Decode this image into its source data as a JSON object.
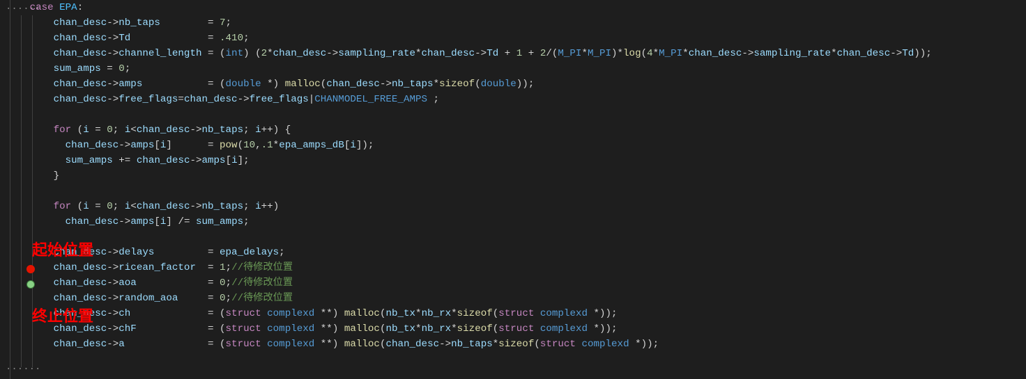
{
  "code": {
    "lines": [
      {
        "indent": 1,
        "segments": [
          [
            "kw",
            "case"
          ],
          [
            "pun",
            " "
          ],
          [
            "enum",
            "EPA"
          ],
          [
            "pun",
            ":"
          ]
        ]
      },
      {
        "indent": 3,
        "segments": [
          [
            "var",
            "chan_desc"
          ],
          [
            "op",
            "->"
          ],
          [
            "var",
            "nb_taps"
          ],
          [
            "pun",
            "        = "
          ],
          [
            "num",
            "7"
          ],
          [
            "pun",
            ";"
          ]
        ]
      },
      {
        "indent": 3,
        "segments": [
          [
            "var",
            "chan_desc"
          ],
          [
            "op",
            "->"
          ],
          [
            "var",
            "Td"
          ],
          [
            "pun",
            "             = "
          ],
          [
            "num",
            ".410"
          ],
          [
            "pun",
            ";"
          ]
        ]
      },
      {
        "indent": 3,
        "segments": [
          [
            "var",
            "chan_desc"
          ],
          [
            "op",
            "->"
          ],
          [
            "var",
            "channel_length"
          ],
          [
            "pun",
            " = ("
          ],
          [
            "type",
            "int"
          ],
          [
            "pun",
            ") ("
          ],
          [
            "num",
            "2"
          ],
          [
            "op",
            "*"
          ],
          [
            "var",
            "chan_desc"
          ],
          [
            "op",
            "->"
          ],
          [
            "var",
            "sampling_rate"
          ],
          [
            "op",
            "*"
          ],
          [
            "var",
            "chan_desc"
          ],
          [
            "op",
            "->"
          ],
          [
            "var",
            "Td"
          ],
          [
            "pun",
            " + "
          ],
          [
            "num",
            "1"
          ],
          [
            "pun",
            " + "
          ],
          [
            "num",
            "2"
          ],
          [
            "op",
            "/"
          ],
          [
            "pun",
            "("
          ],
          [
            "mac",
            "M_PI"
          ],
          [
            "op",
            "*"
          ],
          [
            "mac",
            "M_PI"
          ],
          [
            "pun",
            ")"
          ],
          [
            "op",
            "*"
          ],
          [
            "fn",
            "log"
          ],
          [
            "pun",
            "("
          ],
          [
            "num",
            "4"
          ],
          [
            "op",
            "*"
          ],
          [
            "mac",
            "M_PI"
          ],
          [
            "op",
            "*"
          ],
          [
            "var",
            "chan_desc"
          ],
          [
            "op",
            "->"
          ],
          [
            "var",
            "sampling_rate"
          ],
          [
            "op",
            "*"
          ],
          [
            "var",
            "chan_desc"
          ],
          [
            "op",
            "->"
          ],
          [
            "var",
            "Td"
          ],
          [
            "pun",
            "));"
          ]
        ]
      },
      {
        "indent": 3,
        "segments": [
          [
            "var",
            "sum_amps"
          ],
          [
            "pun",
            " = "
          ],
          [
            "num",
            "0"
          ],
          [
            "pun",
            ";"
          ]
        ]
      },
      {
        "indent": 3,
        "segments": [
          [
            "var",
            "chan_desc"
          ],
          [
            "op",
            "->"
          ],
          [
            "var",
            "amps"
          ],
          [
            "pun",
            "           = ("
          ],
          [
            "type",
            "double"
          ],
          [
            "pun",
            " "
          ],
          [
            "op",
            "*"
          ],
          [
            "pun",
            ") "
          ],
          [
            "fn",
            "malloc"
          ],
          [
            "pun",
            "("
          ],
          [
            "var",
            "chan_desc"
          ],
          [
            "op",
            "->"
          ],
          [
            "var",
            "nb_taps"
          ],
          [
            "op",
            "*"
          ],
          [
            "fn",
            "sizeof"
          ],
          [
            "pun",
            "("
          ],
          [
            "type",
            "double"
          ],
          [
            "pun",
            "));"
          ]
        ]
      },
      {
        "indent": 3,
        "segments": [
          [
            "var",
            "chan_desc"
          ],
          [
            "op",
            "->"
          ],
          [
            "var",
            "free_flags"
          ],
          [
            "op",
            "="
          ],
          [
            "var",
            "chan_desc"
          ],
          [
            "op",
            "->"
          ],
          [
            "var",
            "free_flags"
          ],
          [
            "op",
            "|"
          ],
          [
            "mac",
            "CHANMODEL_FREE_AMPS"
          ],
          [
            "pun",
            " ;"
          ]
        ]
      },
      {
        "indent": 3,
        "segments": []
      },
      {
        "indent": 3,
        "segments": [
          [
            "kw",
            "for"
          ],
          [
            "pun",
            " ("
          ],
          [
            "var",
            "i"
          ],
          [
            "pun",
            " = "
          ],
          [
            "num",
            "0"
          ],
          [
            "pun",
            "; "
          ],
          [
            "var",
            "i"
          ],
          [
            "op",
            "<"
          ],
          [
            "var",
            "chan_desc"
          ],
          [
            "op",
            "->"
          ],
          [
            "var",
            "nb_taps"
          ],
          [
            "pun",
            "; "
          ],
          [
            "var",
            "i"
          ],
          [
            "op",
            "++"
          ],
          [
            "pun",
            ") {"
          ]
        ]
      },
      {
        "indent": 4,
        "segments": [
          [
            "var",
            "chan_desc"
          ],
          [
            "op",
            "->"
          ],
          [
            "var",
            "amps"
          ],
          [
            "pun",
            "["
          ],
          [
            "var",
            "i"
          ],
          [
            "pun",
            "]      = "
          ],
          [
            "fn",
            "pow"
          ],
          [
            "pun",
            "("
          ],
          [
            "num",
            "10"
          ],
          [
            "pun",
            ","
          ],
          [
            "num",
            ".1"
          ],
          [
            "op",
            "*"
          ],
          [
            "var",
            "epa_amps_dB"
          ],
          [
            "pun",
            "["
          ],
          [
            "var",
            "i"
          ],
          [
            "pun",
            "]);"
          ]
        ]
      },
      {
        "indent": 4,
        "segments": [
          [
            "var",
            "sum_amps"
          ],
          [
            "pun",
            " "
          ],
          [
            "op",
            "+="
          ],
          [
            "pun",
            " "
          ],
          [
            "var",
            "chan_desc"
          ],
          [
            "op",
            "->"
          ],
          [
            "var",
            "amps"
          ],
          [
            "pun",
            "["
          ],
          [
            "var",
            "i"
          ],
          [
            "pun",
            "];"
          ]
        ]
      },
      {
        "indent": 3,
        "segments": [
          [
            "pun",
            "}"
          ]
        ]
      },
      {
        "indent": 3,
        "segments": []
      },
      {
        "indent": 3,
        "segments": [
          [
            "kw",
            "for"
          ],
          [
            "pun",
            " ("
          ],
          [
            "var",
            "i"
          ],
          [
            "pun",
            " = "
          ],
          [
            "num",
            "0"
          ],
          [
            "pun",
            "; "
          ],
          [
            "var",
            "i"
          ],
          [
            "op",
            "<"
          ],
          [
            "var",
            "chan_desc"
          ],
          [
            "op",
            "->"
          ],
          [
            "var",
            "nb_taps"
          ],
          [
            "pun",
            "; "
          ],
          [
            "var",
            "i"
          ],
          [
            "op",
            "++"
          ],
          [
            "pun",
            ")"
          ]
        ]
      },
      {
        "indent": 4,
        "segments": [
          [
            "var",
            "chan_desc"
          ],
          [
            "op",
            "->"
          ],
          [
            "var",
            "amps"
          ],
          [
            "pun",
            "["
          ],
          [
            "var",
            "i"
          ],
          [
            "pun",
            "] "
          ],
          [
            "op",
            "/="
          ],
          [
            "pun",
            " "
          ],
          [
            "var",
            "sum_amps"
          ],
          [
            "pun",
            ";"
          ]
        ]
      },
      {
        "indent": 3,
        "segments": []
      },
      {
        "indent": 3,
        "segments": [
          [
            "var",
            "chan_desc"
          ],
          [
            "op",
            "->"
          ],
          [
            "var",
            "delays"
          ],
          [
            "pun",
            "         = "
          ],
          [
            "var",
            "epa_delays"
          ],
          [
            "pun",
            ";"
          ]
        ]
      },
      {
        "indent": 3,
        "segments": [
          [
            "var",
            "chan_desc"
          ],
          [
            "op",
            "->"
          ],
          [
            "var",
            "ricean_factor"
          ],
          [
            "pun",
            "  = "
          ],
          [
            "num",
            "1"
          ],
          [
            "pun",
            ";"
          ],
          [
            "cmt",
            "//待修改位置"
          ]
        ]
      },
      {
        "indent": 3,
        "segments": [
          [
            "var",
            "chan_desc"
          ],
          [
            "op",
            "->"
          ],
          [
            "var",
            "aoa"
          ],
          [
            "pun",
            "            = "
          ],
          [
            "num",
            "0"
          ],
          [
            "pun",
            ";"
          ],
          [
            "cmt",
            "//待修改位置"
          ]
        ]
      },
      {
        "indent": 3,
        "segments": [
          [
            "var",
            "chan_desc"
          ],
          [
            "op",
            "->"
          ],
          [
            "var",
            "random_aoa"
          ],
          [
            "pun",
            "     = "
          ],
          [
            "num",
            "0"
          ],
          [
            "pun",
            ";"
          ],
          [
            "cmt",
            "//待修改位置"
          ]
        ]
      },
      {
        "indent": 3,
        "segments": [
          [
            "var",
            "chan_desc"
          ],
          [
            "op",
            "->"
          ],
          [
            "var",
            "ch"
          ],
          [
            "pun",
            "             = ("
          ],
          [
            "kw",
            "struct"
          ],
          [
            "pun",
            " "
          ],
          [
            "type",
            "complexd"
          ],
          [
            "pun",
            " "
          ],
          [
            "op",
            "**"
          ],
          [
            "pun",
            ") "
          ],
          [
            "fn",
            "malloc"
          ],
          [
            "pun",
            "("
          ],
          [
            "var",
            "nb_tx"
          ],
          [
            "op",
            "*"
          ],
          [
            "var",
            "nb_rx"
          ],
          [
            "op",
            "*"
          ],
          [
            "fn",
            "sizeof"
          ],
          [
            "pun",
            "("
          ],
          [
            "kw",
            "struct"
          ],
          [
            "pun",
            " "
          ],
          [
            "type",
            "complexd"
          ],
          [
            "pun",
            " "
          ],
          [
            "op",
            "*"
          ],
          [
            "pun",
            "));"
          ]
        ]
      },
      {
        "indent": 3,
        "segments": [
          [
            "var",
            "chan_desc"
          ],
          [
            "op",
            "->"
          ],
          [
            "var",
            "chF"
          ],
          [
            "pun",
            "            = ("
          ],
          [
            "kw",
            "struct"
          ],
          [
            "pun",
            " "
          ],
          [
            "type",
            "complexd"
          ],
          [
            "pun",
            " "
          ],
          [
            "op",
            "**"
          ],
          [
            "pun",
            ") "
          ],
          [
            "fn",
            "malloc"
          ],
          [
            "pun",
            "("
          ],
          [
            "var",
            "nb_tx"
          ],
          [
            "op",
            "*"
          ],
          [
            "var",
            "nb_rx"
          ],
          [
            "op",
            "*"
          ],
          [
            "fn",
            "sizeof"
          ],
          [
            "pun",
            "("
          ],
          [
            "kw",
            "struct"
          ],
          [
            "pun",
            " "
          ],
          [
            "type",
            "complexd"
          ],
          [
            "pun",
            " "
          ],
          [
            "op",
            "*"
          ],
          [
            "pun",
            "));"
          ]
        ]
      },
      {
        "indent": 3,
        "segments": [
          [
            "var",
            "chan_desc"
          ],
          [
            "op",
            "->"
          ],
          [
            "var",
            "a"
          ],
          [
            "pun",
            "              = ("
          ],
          [
            "kw",
            "struct"
          ],
          [
            "pun",
            " "
          ],
          [
            "type",
            "complexd"
          ],
          [
            "pun",
            " "
          ],
          [
            "op",
            "**"
          ],
          [
            "pun",
            ") "
          ],
          [
            "fn",
            "malloc"
          ],
          [
            "pun",
            "("
          ],
          [
            "var",
            "chan_desc"
          ],
          [
            "op",
            "->"
          ],
          [
            "var",
            "nb_taps"
          ],
          [
            "op",
            "*"
          ],
          [
            "fn",
            "sizeof"
          ],
          [
            "pun",
            "("
          ],
          [
            "kw",
            "struct"
          ],
          [
            "pun",
            " "
          ],
          [
            "type",
            "complexd"
          ],
          [
            "pun",
            " "
          ],
          [
            "op",
            "*"
          ],
          [
            "pun",
            "));"
          ]
        ]
      }
    ]
  },
  "annotations": {
    "start_label": "起始位置",
    "end_label": "终止位置"
  },
  "gutter": {
    "ellipsis_top": "······",
    "ellipsis_bottom": "······"
  }
}
